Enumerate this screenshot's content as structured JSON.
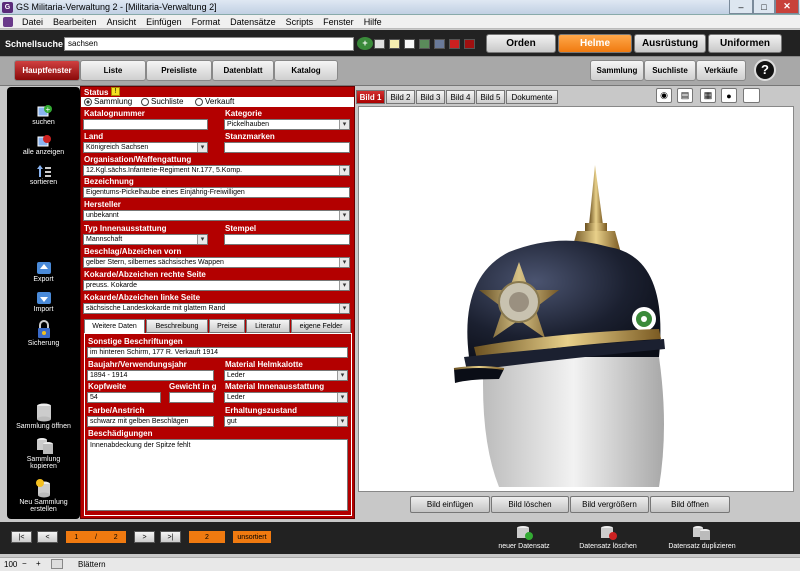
{
  "window": {
    "title": "GS Militaria-Verwaltung 2 - [Militaria-Verwaltung 2]"
  },
  "menu": [
    "Datei",
    "Bearbeiten",
    "Ansicht",
    "Einfügen",
    "Format",
    "Datensätze",
    "Scripts",
    "Fenster",
    "Hilfe"
  ],
  "search": {
    "label": "Schnellsuche",
    "value": "sachsen"
  },
  "swatch_colors": [
    "#e0e0e0",
    "#f5eeb0",
    "#f8f8f8",
    "#5a8a5a",
    "#6a7a9a",
    "#cc2020",
    "#a01010"
  ],
  "categories": [
    "Orden",
    "Helme",
    "Ausrüstung",
    "Uniformen"
  ],
  "nav": {
    "left": [
      "Hauptfenster",
      "Liste",
      "Preisliste",
      "Datenblatt",
      "Katalog"
    ],
    "right": [
      "Sammlung",
      "Suchliste",
      "Verkäufe"
    ],
    "help": "?"
  },
  "sidebar": {
    "search": "suchen",
    "show_all": "alle anzeigen",
    "sort": "sortieren",
    "export": "Export",
    "import": "Import",
    "backup": "Sicherung",
    "open": "Sammlung öffnen",
    "copy": "Sammlung kopieren",
    "new": "Neu Sammlung erstellen"
  },
  "form": {
    "status_label": "Status",
    "status_options": [
      "Sammlung",
      "Suchliste",
      "Verkauft"
    ],
    "catalog_label": "Katalognummer",
    "catalog_value": "",
    "category_label": "Kategorie",
    "category_value": "Pickelhauben",
    "country_label": "Land",
    "country_value": "Königreich Sachsen",
    "stamps_label": "Stanzmarken",
    "stamps_value": "",
    "org_label": "Organisation/Waffengattung",
    "org_value": "12.Kgl.sächs.Infanterie-Regiment Nr.177, 5.Komp.",
    "desc_label": "Bezeichnung",
    "desc_value": "Eigentums-Pickelhaube eines Einjährig-Freiwilligen",
    "maker_label": "Hersteller",
    "maker_value": "unbekannt",
    "lining_label": "Typ Innenausstattung",
    "lining_value": "Mannschaft",
    "stamp_label": "Stempel",
    "stamp_value": "",
    "front_label": "Beschlag/Abzeichen vorn",
    "front_value": "gelber Stern, silbernes sächsisches Wappen",
    "right_label": "Kokarde/Abzeichen rechte Seite",
    "right_value": "preuss. Kokarde",
    "left_label": "Kokarde/Abzeichen linke Seite",
    "left_value": "sächsische Landeskokarde mit glattem Rand",
    "subtabs": [
      "Weitere Daten",
      "Beschreibung",
      "Preise",
      "Literatur",
      "eigene Felder"
    ],
    "inscr_label": "Sonstige Beschriftungen",
    "inscr_value": "im hinteren Schirm, 177 R. Verkauft 1914",
    "year_label": "Baujahr/Verwendungsjahr",
    "year_value": "1894 - 1914",
    "material_label": "Material Helmkalotte",
    "material_value": "Leder",
    "size_label": "Kopfweite",
    "size_value": "54",
    "weight_label": "Gewicht in g",
    "weight_value": "",
    "inner_label": "Material Innenausstattung",
    "inner_value": "Leder",
    "color_label": "Farbe/Anstrich",
    "color_value": "schwarz mit gelben Beschlägen",
    "cond_label": "Erhaltungszustand",
    "cond_value": "gut",
    "damage_label": "Beschädigungen",
    "damage_value": "Innenabdeckung der Spitze fehlt"
  },
  "image_tabs": [
    "Bild 1",
    "Bild 2",
    "Bild 3",
    "Bild 4",
    "Bild 5",
    "Dokumente"
  ],
  "image_buttons": [
    "Bild einfügen",
    "Bild löschen",
    "Bild vergrößern",
    "Bild öffnen"
  ],
  "pager": {
    "first": "|<",
    "prev": "<",
    "current": "1",
    "sep": "/",
    "total": "2",
    "next": ">",
    "last": ">|",
    "found": "2",
    "sort": "unsortiert"
  },
  "actions": [
    "neuer Datensatz",
    "Datensatz löschen",
    "Datensatz duplizieren"
  ],
  "status_bar": {
    "zoom": "100",
    "mode": "Blättern"
  }
}
